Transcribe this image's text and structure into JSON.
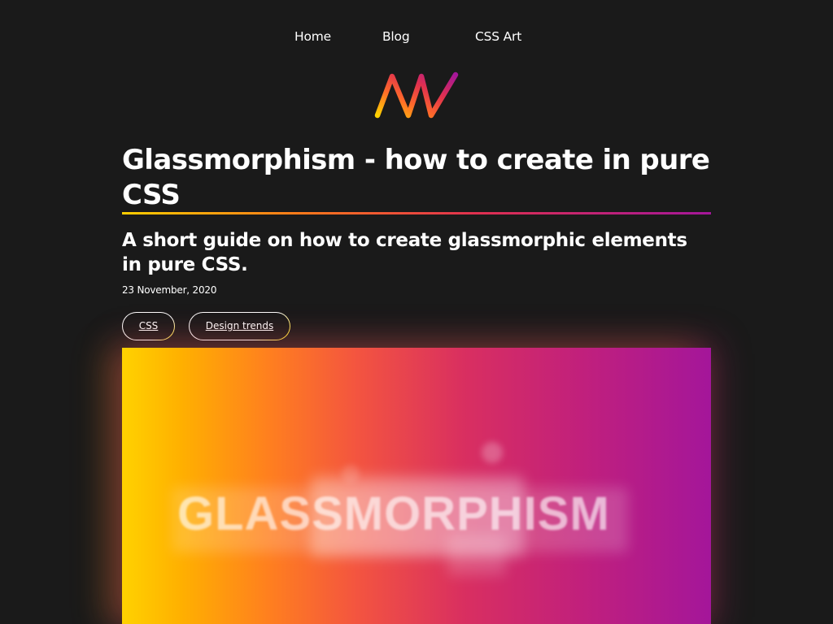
{
  "nav": {
    "items": [
      {
        "label": "Home"
      },
      {
        "label": "Blog"
      },
      {
        "label": "CSS Art"
      }
    ]
  },
  "logo": {
    "icon": "aw-logo-icon",
    "colors": [
      "#ffd200",
      "#ff6a2a",
      "#e0304f",
      "#a4169a"
    ]
  },
  "article": {
    "title": "Glassmorphism - how to create in pure CSS",
    "subtitle": "A short guide on how to create glassmorphic elements in pure CSS.",
    "date": "23 November, 2020",
    "tags": [
      {
        "label": "CSS"
      },
      {
        "label": "Design trends"
      }
    ]
  },
  "hero": {
    "word": "GLASSMORPHISM",
    "gradient": [
      "#ffd200",
      "#ff7f1f",
      "#d92f60",
      "#a4169a"
    ]
  }
}
